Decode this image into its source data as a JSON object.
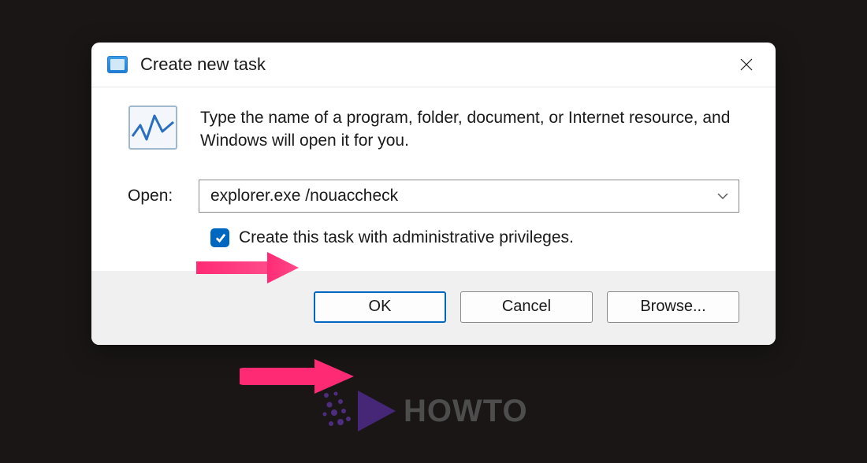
{
  "dialog": {
    "title": "Create new task",
    "description": "Type the name of a program, folder, document, or Internet resource, and Windows will open it for you.",
    "open_label": "Open:",
    "open_value": "explorer.exe /nouaccheck",
    "admin_checkbox_label": "Create this task with administrative privileges.",
    "admin_checkbox_checked": true,
    "buttons": {
      "ok": "OK",
      "cancel": "Cancel",
      "browse": "Browse..."
    }
  },
  "watermark": "HOWTO",
  "colors": {
    "accent": "#0067c0",
    "annotation": "#ff2a74"
  }
}
